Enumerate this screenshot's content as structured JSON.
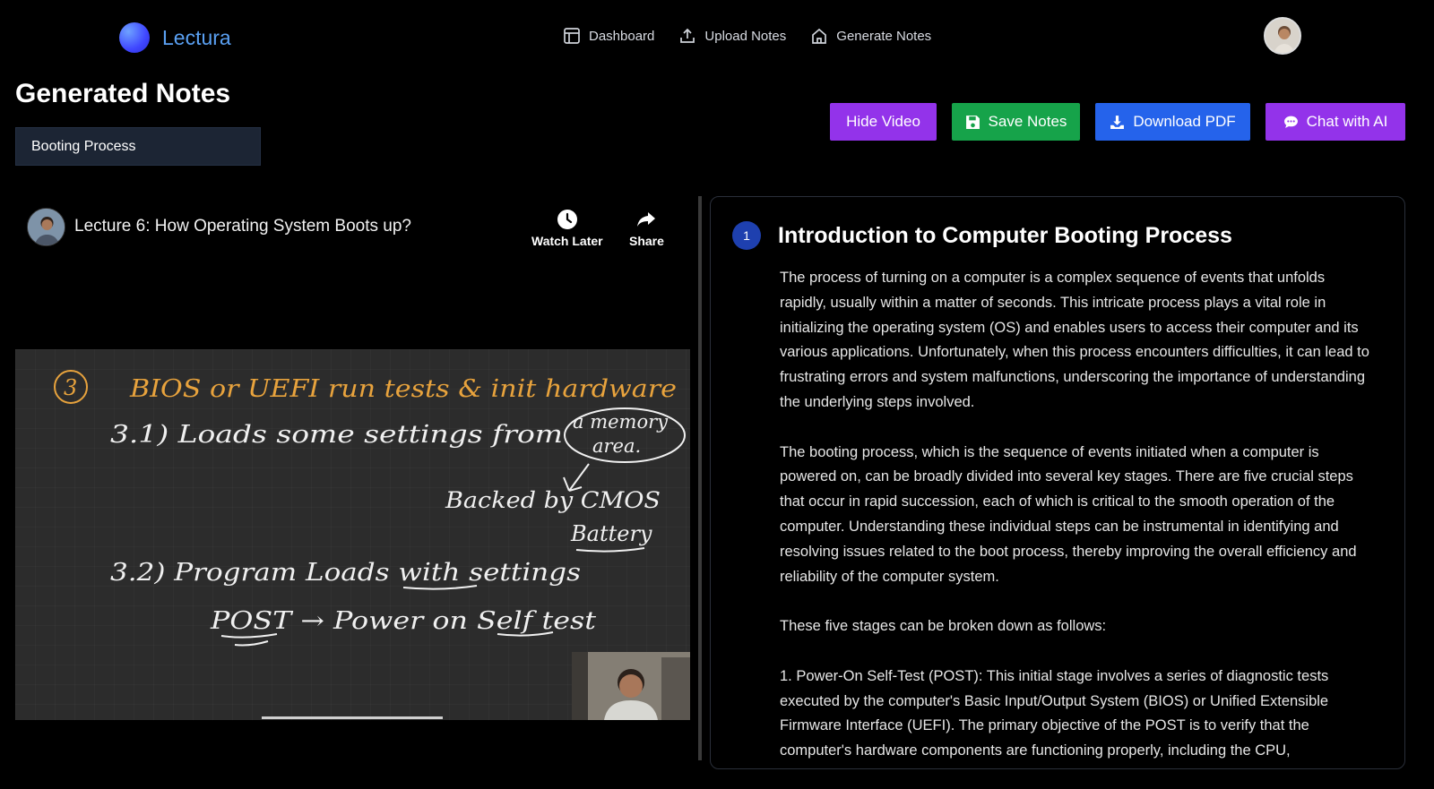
{
  "brand": {
    "name": "Lectura"
  },
  "nav": {
    "links": [
      {
        "label": "Dashboard",
        "icon": "dashboard-icon"
      },
      {
        "label": "Upload Notes",
        "icon": "upload-icon"
      },
      {
        "label": "Generate Notes",
        "icon": "home-icon"
      }
    ]
  },
  "page": {
    "title": "Generated Notes",
    "topic_value": "Booting Process"
  },
  "actions": {
    "hide_video": "Hide Video",
    "save_notes": "Save Notes",
    "download_pdf": "Download PDF",
    "chat_ai": "Chat with AI"
  },
  "video": {
    "title": "Lecture 6: How Operating System Boots up?",
    "watch_later": "Watch Later",
    "share": "Share",
    "board": {
      "n": "3",
      "line1": "BIOS or UEFI run tests & init hardware",
      "line2": "3.1)  Loads  some  settings  from",
      "bubble1": "a memory",
      "bubble2": "area.",
      "backed": "Backed by CMOS",
      "battery": "Battery",
      "line3": "3.2)  Program Loads with settings",
      "line4": "POST →  Power on Self test"
    }
  },
  "notes": {
    "section_number": "1",
    "section_title": "Introduction to Computer Booting Process",
    "paragraphs": [
      "The process of turning on a computer is a complex sequence of events that unfolds rapidly, usually within a matter of seconds. This intricate process plays a vital role in initializing the operating system (OS) and enables users to access their computer and its various applications. Unfortunately, when this process encounters difficulties, it can lead to frustrating errors and system malfunctions, underscoring the importance of understanding the underlying steps involved.",
      "The booting process, which is the sequence of events initiated when a computer is powered on, can be broadly divided into several key stages. There are five crucial steps that occur in rapid succession, each of which is critical to the smooth operation of the computer. Understanding these individual steps can be instrumental in identifying and resolving issues related to the boot process, thereby improving the overall efficiency and reliability of the computer system.",
      "These five stages can be broken down as follows:",
      "1. Power-On Self-Test (POST): This initial stage involves a series of diagnostic tests executed by the computer's Basic Input/Output System (BIOS) or Unified Extensible Firmware Interface (UEFI). The primary objective of the POST is to verify that the computer's hardware components are functioning properly, including the CPU,"
    ]
  },
  "colors": {
    "accent_purple": "#9333ea",
    "accent_green": "#16a34a",
    "accent_blue": "#2563eb",
    "brand_text": "#5aa0f2",
    "chalk_orange": "#e8a33d"
  }
}
